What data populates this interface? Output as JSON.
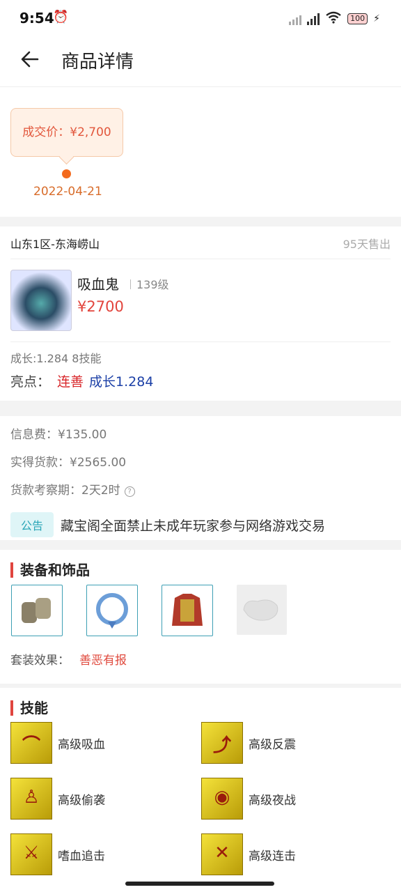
{
  "status_bar": {
    "time": "9:54",
    "battery": "100"
  },
  "header": {
    "title": "商品详情"
  },
  "price_history": {
    "deal_label": "成交价：¥2,700",
    "date": "2022-04-21"
  },
  "listing": {
    "server": "山东1区-东海崂山",
    "sold": "95天售出",
    "pet": {
      "name": "吸血鬼",
      "level": "139级",
      "price": "¥2700"
    },
    "growth_skills": "成长:1.284  8技能",
    "highlights": {
      "label": "亮点：",
      "tag1": "连善",
      "tag2": "成长1.284"
    }
  },
  "fees": {
    "info_fee": "信息费：¥135.00",
    "actual": "实得货款：¥2565.00",
    "period": "货款考察期：2天2时",
    "notice_tag": "公告",
    "notice_text": "藏宝阁全面禁止未成年玩家参与网络游戏交易"
  },
  "equipment": {
    "title": "装备和饰品",
    "items": [
      "bracers",
      "ring",
      "armor",
      "empty-slot"
    ],
    "set_label": "套装效果：",
    "set_value": "善恶有报"
  },
  "skills": {
    "title": "技能",
    "items": [
      "高级吸血",
      "高级反震",
      "高级偷袭",
      "高级夜战",
      "嗜血追击",
      "高级连击"
    ]
  }
}
